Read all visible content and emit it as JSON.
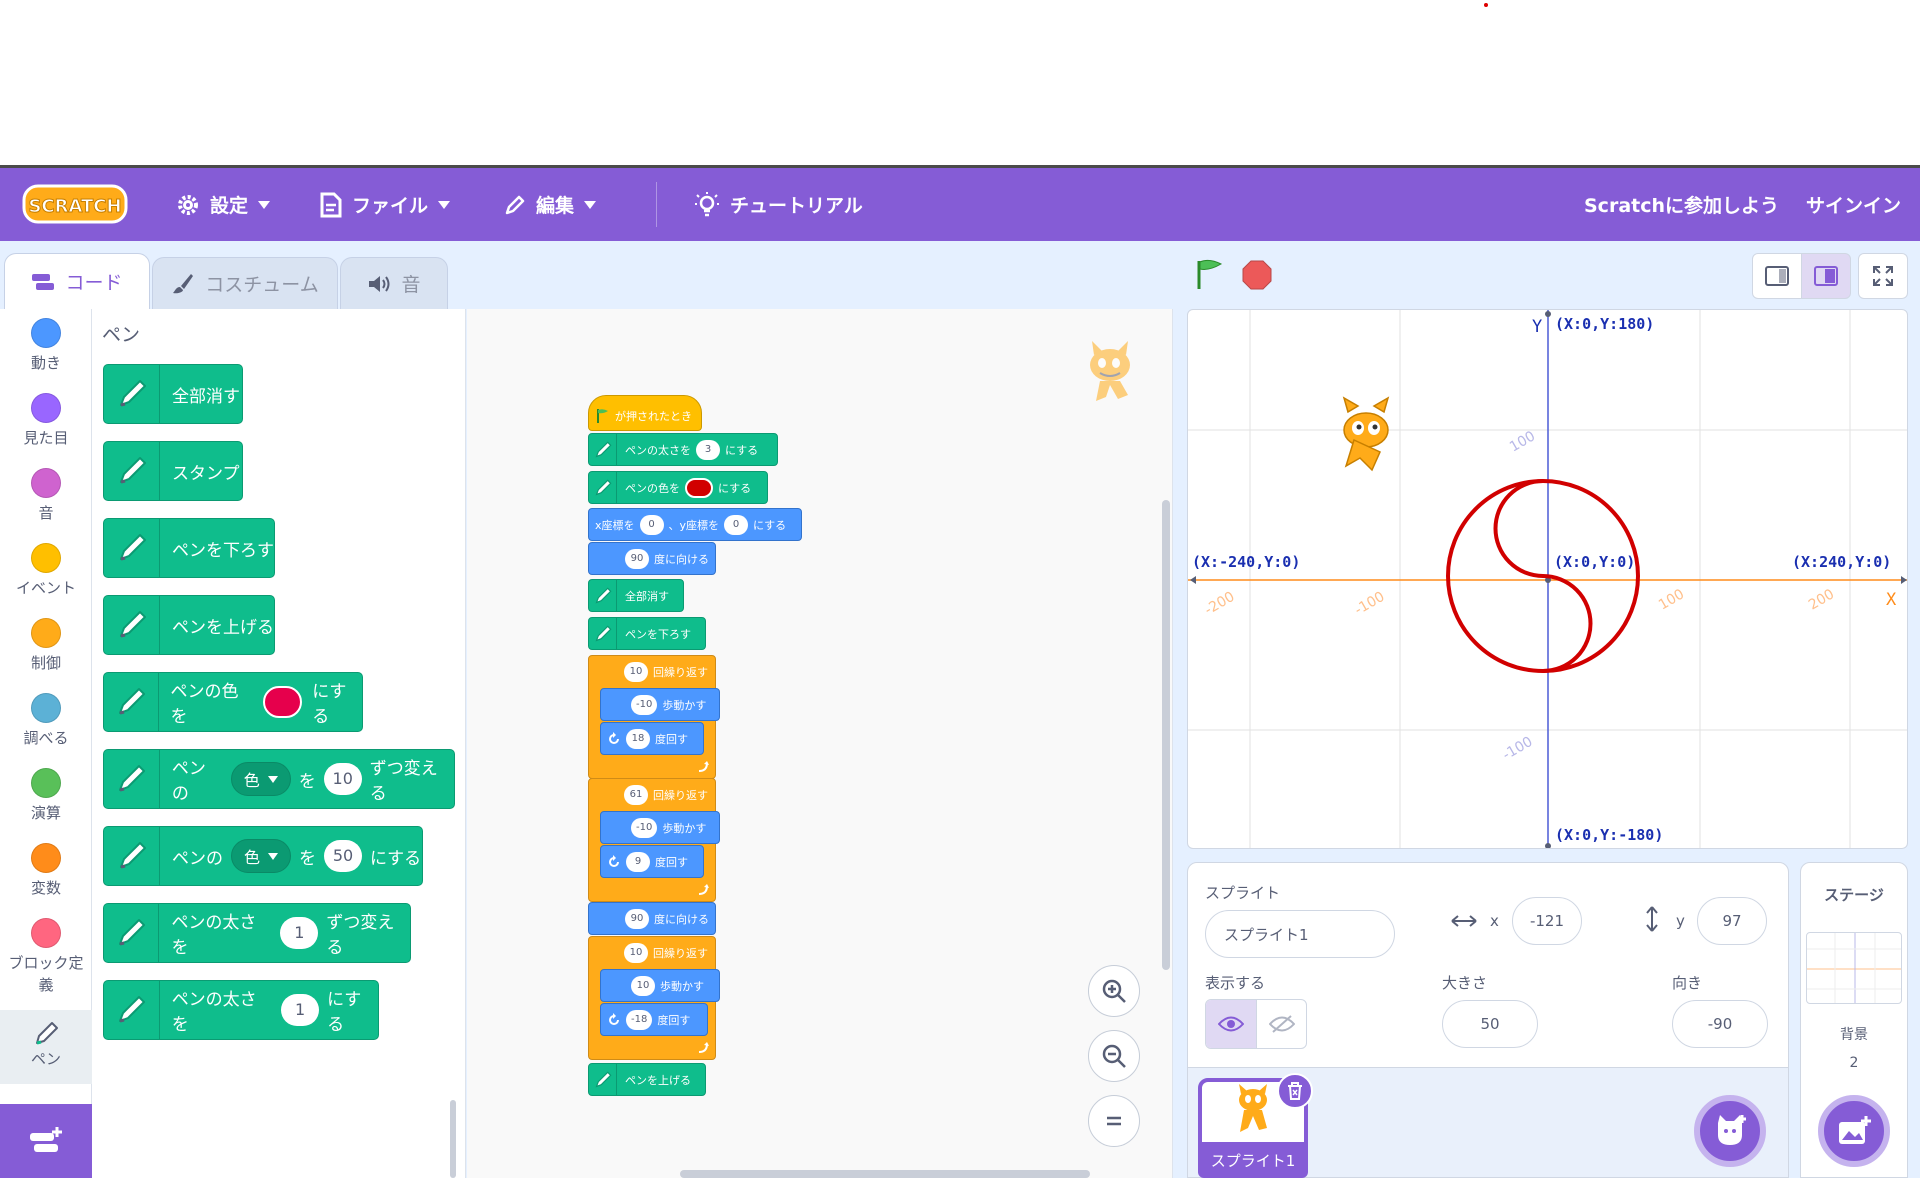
{
  "menubar": {
    "logo_text": "SCRATCH",
    "settings": "設定",
    "file": "ファイル",
    "edit": "編集",
    "tutorial": "チュートリアル",
    "join": "Scratchに参加しよう",
    "signin": "サインイン"
  },
  "tabs": {
    "code": "コード",
    "costumes": "コスチューム",
    "sounds": "音"
  },
  "categories": [
    {
      "label": "動き",
      "color": "#4c97ff"
    },
    {
      "label": "見た目",
      "color": "#9966ff"
    },
    {
      "label": "音",
      "color": "#cf63cf"
    },
    {
      "label": "イベント",
      "color": "#ffbf00"
    },
    {
      "label": "制御",
      "color": "#ffab19"
    },
    {
      "label": "調べる",
      "color": "#5cb1d6"
    },
    {
      "label": "演算",
      "color": "#59c059"
    },
    {
      "label": "変数",
      "color": "#ff8c1a"
    },
    {
      "label": "ブロック定義",
      "color": "#ff6680"
    },
    {
      "label": "ペン",
      "color": "#0fbd8c"
    }
  ],
  "palette": {
    "title": "ペン",
    "clear": "全部消す",
    "stamp": "スタンプ",
    "pen_down": "ペンを下ろす",
    "pen_up": "ペンを上げる",
    "set_color_a": "ペンの色を",
    "set_color_b": "にする",
    "change_param_a": "ペンの",
    "change_param_drop": "色",
    "change_param_b": "を",
    "change_param_val": "10",
    "change_param_c": "ずつ変える",
    "set_param_a": "ペンの",
    "set_param_drop": "色",
    "set_param_b": "を",
    "set_param_val": "50",
    "set_param_c": "にする",
    "change_size_a": "ペンの太さを",
    "change_size_val": "1",
    "change_size_b": "ずつ変える",
    "set_size_a": "ペンの太さを",
    "set_size_val": "1",
    "set_size_b": "にする"
  },
  "script": {
    "hat": "が押されたとき",
    "size_a": "ペンの太さを",
    "size_val": "3",
    "size_b": "にする",
    "color_a": "ペンの色を",
    "color_b": "にする",
    "goto_a": "x座標を",
    "goto_x": "0",
    "goto_mid": "、y座標を",
    "goto_y": "0",
    "goto_b": "にする",
    "dir1_val": "90",
    "dir_label": "度に向ける",
    "clear": "全部消す",
    "pen_down": "ペンを下ろす",
    "repeat1_val": "10",
    "repeat_label": "回繰り返す",
    "move1_val": "-10",
    "move_label": "歩動かす",
    "turn1_val": "18",
    "turn_label": "度回す",
    "repeat2_val": "61",
    "move2_val": "-10",
    "turn2_val": "9",
    "dir2_val": "90",
    "repeat3_val": "10",
    "move3_val": "10",
    "turn3_val": "-18",
    "pen_up": "ペンを上げる"
  },
  "stage": {
    "y_axis": "Y",
    "x_axis": "X",
    "top_coord": "(X:0,Y:180)",
    "bottom_coord": "(X:0,Y:-180)",
    "left_coord": "(X:-240,Y:0)",
    "right_coord": "(X:240,Y:0)",
    "center_coord": "(X:0,Y:0)",
    "tick_y_pos": "100",
    "tick_y_neg": "-100",
    "tick_x_n200": "-200",
    "tick_x_n100": "-100",
    "tick_x_p100": "100",
    "tick_x_p200": "200"
  },
  "sprite_info": {
    "label_sprite": "スプライト",
    "name": "スプライト1",
    "x_label": "x",
    "x_val": "-121",
    "y_label": "y",
    "y_val": "97",
    "show_label": "表示する",
    "size_label": "大きさ",
    "size_val": "50",
    "direction_label": "向き",
    "direction_val": "-90",
    "thumb_label": "スプライト1"
  },
  "stage_panel": {
    "title": "ステージ",
    "backdrops_label": "背景",
    "backdrops_count": "2"
  },
  "colors": {
    "accent": "#855cd6",
    "pen": "#0fbd8c",
    "motion": "#4c97ff",
    "control": "#ffab19",
    "event": "#ffbf00",
    "drawing": "#d10000"
  }
}
